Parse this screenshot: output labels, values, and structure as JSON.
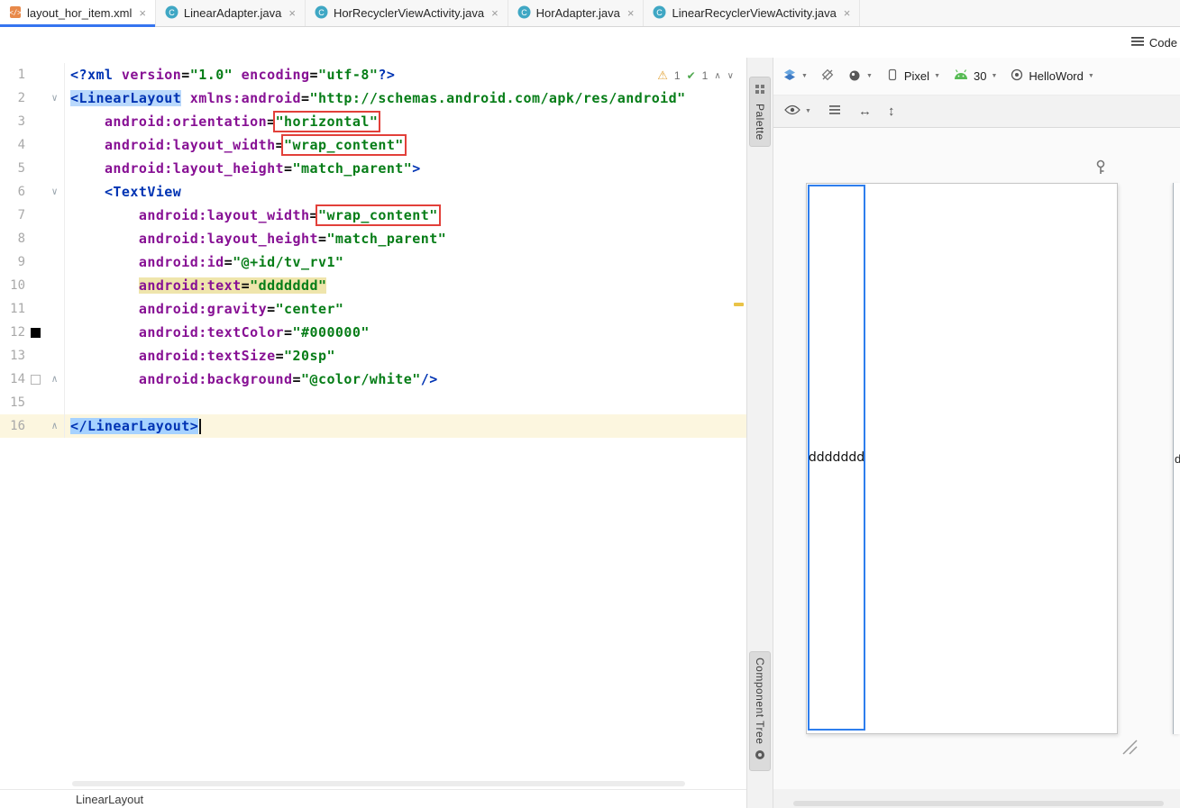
{
  "colors": {
    "accent_blue": "#3574F0",
    "selection_blue": "#A6D2FF",
    "tag_match_blue": "#BAD9FC",
    "caret_row": "#FCF6DF",
    "usage_highlight": "#EFE5AC",
    "annotation_red": "#E2403A",
    "syntax_tag": "#0033B3",
    "syntax_attribute": "#871094",
    "syntax_value": "#067D17",
    "component_border_blue": "#2E7EED",
    "android_green": "#57BB54",
    "warning_yellow": "#E9C347",
    "swatch_black": "#000000",
    "swatch_white": "#FFFFFF"
  },
  "icons": {
    "close": "×",
    "dropdown": "▼",
    "warning": "⚠",
    "check": "✔",
    "chevron_up": "∧",
    "chevron_down": "∨",
    "fold_down": "∨",
    "fold_up": "∧",
    "arrow_horizontal": "↔",
    "arrow_vertical": "↕"
  },
  "tabs": [
    {
      "label": "layout_hor_item.xml",
      "type": "xml-file",
      "active": true
    },
    {
      "label": "LinearAdapter.java",
      "type": "class",
      "active": false
    },
    {
      "label": "HorRecyclerViewActivity.java",
      "type": "class",
      "active": false
    },
    {
      "label": "HorAdapter.java",
      "type": "class",
      "active": false
    },
    {
      "label": "LinearRecyclerViewActivity.java",
      "type": "class",
      "active": false
    }
  ],
  "mode_switcher": {
    "label": "Code"
  },
  "editor": {
    "inspections": {
      "warnings": "1",
      "passed": "1"
    },
    "lines": [
      {
        "n": "1",
        "tokens": [
          {
            "t": "<?xml ",
            "c": "tag"
          },
          {
            "t": "version",
            "c": "attr"
          },
          {
            "t": "=",
            "c": "plain"
          },
          {
            "t": "\"1.0\"",
            "c": "val"
          },
          {
            "t": " ",
            "c": "plain"
          },
          {
            "t": "encoding",
            "c": "attr"
          },
          {
            "t": "=",
            "c": "plain"
          },
          {
            "t": "\"utf-8\"",
            "c": "val"
          },
          {
            "t": "?>",
            "c": "tag"
          }
        ]
      },
      {
        "n": "2",
        "fold": "down",
        "tokens": [
          {
            "t": "<LinearLayout",
            "c": "tag",
            "sel": "light"
          },
          {
            "t": " ",
            "c": "plain"
          },
          {
            "t": "xmlns:android",
            "c": "attr"
          },
          {
            "t": "=",
            "c": "plain"
          },
          {
            "t": "\"http://schemas.android.com/apk/res/android\"",
            "c": "val"
          }
        ]
      },
      {
        "n": "3",
        "tokens": [
          {
            "t": "    ",
            "c": "plain"
          },
          {
            "t": "android:orientation",
            "c": "attr"
          },
          {
            "t": "=",
            "c": "plain"
          },
          {
            "t": "\"horizontal\"",
            "c": "val",
            "box": true
          }
        ]
      },
      {
        "n": "4",
        "tokens": [
          {
            "t": "    ",
            "c": "plain"
          },
          {
            "t": "android:layout_width",
            "c": "attr"
          },
          {
            "t": "=",
            "c": "plain"
          },
          {
            "t": "\"wrap_content\"",
            "c": "val",
            "box": true
          }
        ]
      },
      {
        "n": "5",
        "tokens": [
          {
            "t": "    ",
            "c": "plain"
          },
          {
            "t": "android:layout_height",
            "c": "attr"
          },
          {
            "t": "=",
            "c": "plain"
          },
          {
            "t": "\"match_parent\"",
            "c": "val"
          },
          {
            "t": ">",
            "c": "tag"
          }
        ]
      },
      {
        "n": "6",
        "fold": "down",
        "tokens": [
          {
            "t": "    ",
            "c": "plain"
          },
          {
            "t": "<TextView",
            "c": "tag"
          }
        ]
      },
      {
        "n": "7",
        "tokens": [
          {
            "t": "        ",
            "c": "plain"
          },
          {
            "t": "android:layout_width",
            "c": "attr"
          },
          {
            "t": "=",
            "c": "plain"
          },
          {
            "t": "\"wrap_content\"",
            "c": "val",
            "box": true
          }
        ]
      },
      {
        "n": "8",
        "tokens": [
          {
            "t": "        ",
            "c": "plain"
          },
          {
            "t": "android:layout_height",
            "c": "attr"
          },
          {
            "t": "=",
            "c": "plain"
          },
          {
            "t": "\"match_parent\"",
            "c": "val"
          }
        ]
      },
      {
        "n": "9",
        "tokens": [
          {
            "t": "        ",
            "c": "plain"
          },
          {
            "t": "android:id",
            "c": "attr"
          },
          {
            "t": "=",
            "c": "plain"
          },
          {
            "t": "\"@+id/tv_rv1\"",
            "c": "val"
          }
        ]
      },
      {
        "n": "10",
        "tokens": [
          {
            "t": "        ",
            "c": "plain"
          },
          {
            "t": "android:text",
            "c": "attr",
            "hl": true
          },
          {
            "t": "=",
            "c": "plain",
            "hl": true
          },
          {
            "t": "\"ddddddd\"",
            "c": "val",
            "hl": true
          }
        ]
      },
      {
        "n": "11",
        "tokens": [
          {
            "t": "        ",
            "c": "plain"
          },
          {
            "t": "android:gravity",
            "c": "attr"
          },
          {
            "t": "=",
            "c": "plain"
          },
          {
            "t": "\"center\"",
            "c": "val"
          }
        ]
      },
      {
        "n": "12",
        "swatch": "#000000",
        "tokens": [
          {
            "t": "        ",
            "c": "plain"
          },
          {
            "t": "android:textColor",
            "c": "attr"
          },
          {
            "t": "=",
            "c": "plain"
          },
          {
            "t": "\"#000000\"",
            "c": "val"
          }
        ]
      },
      {
        "n": "13",
        "tokens": [
          {
            "t": "        ",
            "c": "plain"
          },
          {
            "t": "android:textSize",
            "c": "attr"
          },
          {
            "t": "=",
            "c": "plain"
          },
          {
            "t": "\"20sp\"",
            "c": "val"
          }
        ]
      },
      {
        "n": "14",
        "swatch": "#FFFFFF",
        "fold": "up",
        "tokens": [
          {
            "t": "        ",
            "c": "plain"
          },
          {
            "t": "android:background",
            "c": "attr"
          },
          {
            "t": "=",
            "c": "plain"
          },
          {
            "t": "\"@color/white\"",
            "c": "val"
          },
          {
            "t": "/>",
            "c": "tag"
          }
        ]
      },
      {
        "n": "15",
        "tokens": []
      },
      {
        "n": "16",
        "fold": "up",
        "caret_row": true,
        "caret": true,
        "tokens": [
          {
            "t": "</LinearLayout>",
            "c": "tag",
            "sel": "strong"
          }
        ]
      }
    ]
  },
  "design": {
    "palette_label": "Palette",
    "component_tree_label": "Component Tree",
    "toolbar": {
      "device_label": "Pixel",
      "api_label": "30",
      "theme_label": "HelloWord"
    },
    "preview_text": "ddddddd",
    "blueprint_text": "d"
  },
  "status": {
    "breadcrumb": "LinearLayout"
  }
}
